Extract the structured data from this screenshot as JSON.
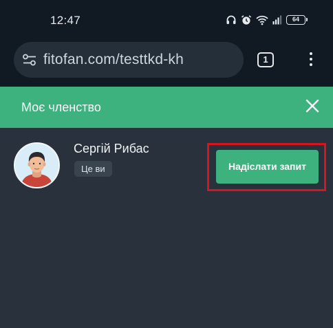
{
  "status_bar": {
    "time": "12:47",
    "battery": "64",
    "icons": [
      "headphones-icon",
      "alarm-icon",
      "wifi-icon",
      "signal-icon",
      "battery-icon"
    ]
  },
  "browser": {
    "url": "fitofan.com/testtkd-kh",
    "tab_count": "1",
    "site_settings_icon": "tune-icon",
    "menu_icon": "more-vert-icon"
  },
  "header": {
    "title": "Моє членство",
    "close_icon": "close-icon",
    "color": "#3db27f"
  },
  "member": {
    "name": "Сергій Рибас",
    "badge": "Це ви",
    "action_label": "Надіслати запит",
    "highlight_color": "#d9141f"
  }
}
